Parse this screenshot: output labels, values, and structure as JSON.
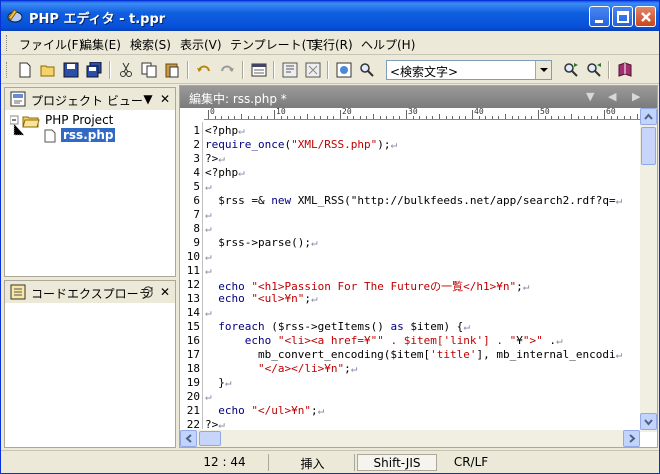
{
  "window": {
    "title": "PHP エディタ - t.ppr"
  },
  "menu": [
    "ファイル(F)",
    "編集(E)",
    "検索(S)",
    "表示(V)",
    "テンプレート(T)",
    "実行(R)",
    "ヘルプ(H)"
  ],
  "toolbar": {
    "search_value": "<検索文字>"
  },
  "project_panel": {
    "title": "プロジェクト ビュー",
    "root": "PHP Project",
    "file": "rss.php"
  },
  "explorer_panel": {
    "title": "コードエクスプローラ"
  },
  "editor": {
    "tab_title": "編集中: rss.php *",
    "ruler_labels": [
      "0",
      "10",
      "20",
      "30",
      "40",
      "50",
      "60"
    ],
    "lines": [
      {
        "n": "1",
        "text": "<?php"
      },
      {
        "n": "2",
        "text": "require_once(\"XML/RSS.php\");"
      },
      {
        "n": "3",
        "text": "?>"
      },
      {
        "n": "4",
        "text": "<?php"
      },
      {
        "n": "5",
        "text": ""
      },
      {
        "n": "6",
        "text": "  $rss =& new XML_RSS(\"http://bulkfeeds.net/app/search2.rdf?q="
      },
      {
        "n": "7",
        "text": ""
      },
      {
        "n": "8",
        "text": ""
      },
      {
        "n": "9",
        "text": "  $rss->parse();"
      },
      {
        "n": "10",
        "text": ""
      },
      {
        "n": "11",
        "text": ""
      },
      {
        "n": "12",
        "text": "  echo \"<h1>Passion For The Futureの一覧</h1>¥n\";"
      },
      {
        "n": "13",
        "text": "  echo \"<ul>¥n\";"
      },
      {
        "n": "14",
        "text": ""
      },
      {
        "n": "15",
        "text": "  foreach ($rss->getItems() as $item) {"
      },
      {
        "n": "16",
        "text": "      echo \"<li><a href=¥\"\" . $item['link'] . \"¥\">\" ."
      },
      {
        "n": "17",
        "text": "        mb_convert_encoding($item['title'], mb_internal_encodi"
      },
      {
        "n": "18",
        "text": "        \"</a></li>¥n\";"
      },
      {
        "n": "19",
        "text": "  }"
      },
      {
        "n": "20",
        "text": ""
      },
      {
        "n": "21",
        "text": "  echo \"</ul>¥n\";"
      },
      {
        "n": "22",
        "text": "?>"
      }
    ]
  },
  "status": {
    "position": "12 : 44",
    "mode": "挿入",
    "encoding": "Shift-JIS",
    "newline": "CR/LF"
  },
  "colors": {
    "title_bar": "#0a5ddd",
    "selection": "#316ac5",
    "editor_header": "#8a8a8a"
  }
}
